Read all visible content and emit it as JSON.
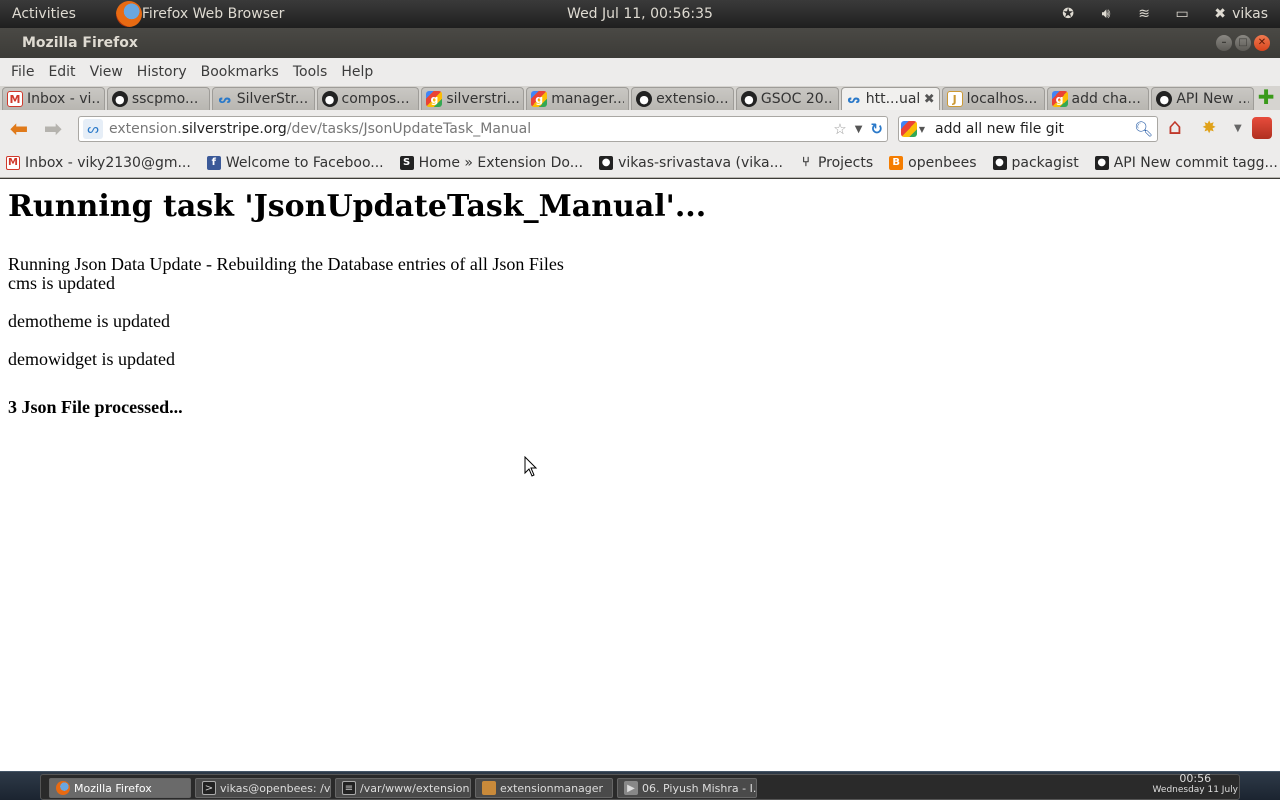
{
  "top_panel": {
    "activities": "Activities",
    "app_name": "Firefox Web Browser",
    "clock": "Wed Jul 11, 00:56:35",
    "user": "vikas"
  },
  "window": {
    "title": "Mozilla Firefox"
  },
  "menu": {
    "items": [
      "File",
      "Edit",
      "View",
      "History",
      "Bookmarks",
      "Tools",
      "Help"
    ]
  },
  "tabs": [
    {
      "label": "Inbox - vi...",
      "icon": "gmail-icon"
    },
    {
      "label": "sscpmo...",
      "icon": "github-icon"
    },
    {
      "label": "SilverStr...",
      "icon": "silverstripe-icon"
    },
    {
      "label": "compos...",
      "icon": "github-icon"
    },
    {
      "label": "silverstri...",
      "icon": "google-icon"
    },
    {
      "label": "manager...",
      "icon": "google-icon"
    },
    {
      "label": "extensio...",
      "icon": "github-icon"
    },
    {
      "label": "GSOC 20...",
      "icon": "github-icon"
    },
    {
      "label": "htt...ual",
      "icon": "silverstripe-icon",
      "active": true
    },
    {
      "label": "localhos...",
      "icon": "java-icon"
    },
    {
      "label": "add cha...",
      "icon": "google-icon"
    },
    {
      "label": "API New ...",
      "icon": "github-icon"
    }
  ],
  "navbar": {
    "url_prefix": "extension.",
    "url_domain": "silverstripe.org",
    "url_path": "/dev/tasks/JsonUpdateTask_Manual",
    "search_value": "add all new file git"
  },
  "bookmarks": [
    {
      "label": "Inbox - viky2130@gm...",
      "icon": "gmail-icon"
    },
    {
      "label": "Welcome to Faceboo...",
      "icon": "facebook-icon"
    },
    {
      "label": "Home » Extension Do...",
      "icon": "s-icon"
    },
    {
      "label": "vikas-srivastava (vika...",
      "icon": "github-icon"
    },
    {
      "label": "Projects",
      "icon": "projects-icon"
    },
    {
      "label": "openbees",
      "icon": "blogger-icon"
    },
    {
      "label": "packagist",
      "icon": "github-icon"
    },
    {
      "label": "API New commit tagg...",
      "icon": "github-icon"
    }
  ],
  "page": {
    "heading": "Running task 'JsonUpdateTask_Manual'...",
    "lead": "Running Json Data Update - Rebuilding the Database entries of all Json Files",
    "updates": [
      "cms is updated",
      "demotheme is updated",
      "demowidget is updated"
    ],
    "summary": "3 Json File processed..."
  },
  "taskbar": {
    "tasks": [
      {
        "label": "Mozilla Firefox",
        "icon": "firefox-icon",
        "active": true
      },
      {
        "label": "vikas@openbees: /v...",
        "icon": "terminal-icon"
      },
      {
        "label": "/var/www/extension....",
        "icon": "editor-icon"
      },
      {
        "label": "extensionmanager",
        "icon": "folder-icon"
      },
      {
        "label": "06. Piyush Mishra - I...",
        "icon": "media-icon"
      }
    ],
    "time": "00:56",
    "date": "Wednesday 11 July"
  }
}
